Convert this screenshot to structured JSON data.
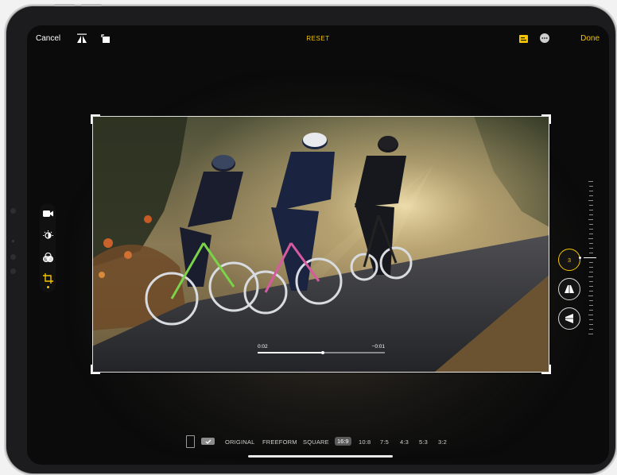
{
  "toolbar": {
    "cancel_label": "Cancel",
    "reset_label": "RESET",
    "done_label": "Done",
    "accent": "#f4c400"
  },
  "icons": {
    "flip": "flip-horizontal-icon",
    "rotate": "rotate-icon",
    "aspect": "aspect-ratio-icon",
    "more": "more-icon"
  },
  "video": {
    "elapsed": "0:02",
    "remaining": "−0:01",
    "progress": 0.5
  },
  "adjust": {
    "value": "3"
  },
  "sidebar": {
    "tools": [
      {
        "name": "video-icon"
      },
      {
        "name": "adjust-icon"
      },
      {
        "name": "filters-icon"
      },
      {
        "name": "crop-icon"
      }
    ]
  },
  "aspect_bar": {
    "options": [
      "ORIGINAL",
      "FREEFORM",
      "SQUARE",
      "16:9",
      "10:8",
      "7:5",
      "4:3",
      "5:3",
      "3:2"
    ],
    "selected": "16:9"
  }
}
